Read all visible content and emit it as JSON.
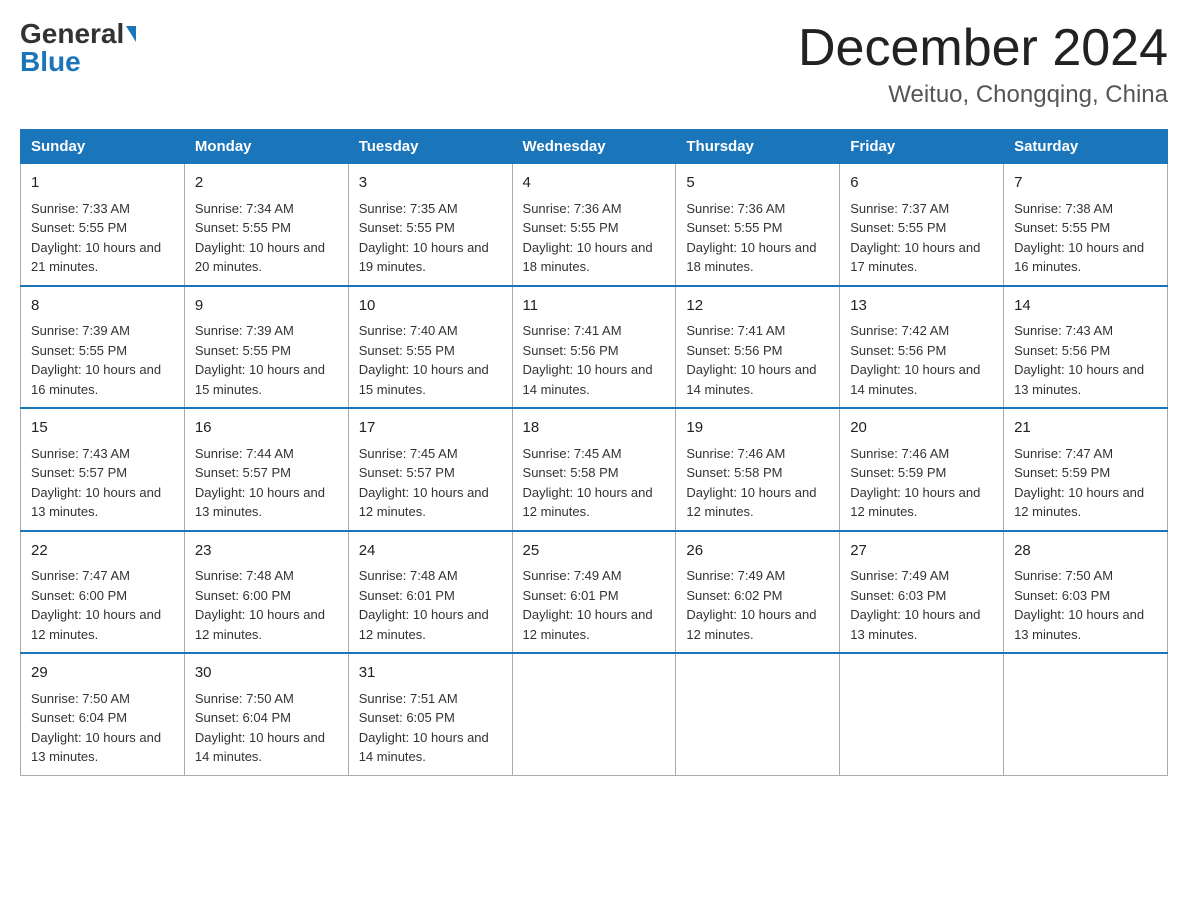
{
  "header": {
    "logo": {
      "general": "General",
      "blue": "Blue"
    },
    "title": "December 2024",
    "location": "Weituo, Chongqing, China"
  },
  "days_of_week": [
    "Sunday",
    "Monday",
    "Tuesday",
    "Wednesday",
    "Thursday",
    "Friday",
    "Saturday"
  ],
  "weeks": [
    [
      {
        "day": "1",
        "sunrise": "7:33 AM",
        "sunset": "5:55 PM",
        "daylight": "10 hours and 21 minutes."
      },
      {
        "day": "2",
        "sunrise": "7:34 AM",
        "sunset": "5:55 PM",
        "daylight": "10 hours and 20 minutes."
      },
      {
        "day": "3",
        "sunrise": "7:35 AM",
        "sunset": "5:55 PM",
        "daylight": "10 hours and 19 minutes."
      },
      {
        "day": "4",
        "sunrise": "7:36 AM",
        "sunset": "5:55 PM",
        "daylight": "10 hours and 18 minutes."
      },
      {
        "day": "5",
        "sunrise": "7:36 AM",
        "sunset": "5:55 PM",
        "daylight": "10 hours and 18 minutes."
      },
      {
        "day": "6",
        "sunrise": "7:37 AM",
        "sunset": "5:55 PM",
        "daylight": "10 hours and 17 minutes."
      },
      {
        "day": "7",
        "sunrise": "7:38 AM",
        "sunset": "5:55 PM",
        "daylight": "10 hours and 16 minutes."
      }
    ],
    [
      {
        "day": "8",
        "sunrise": "7:39 AM",
        "sunset": "5:55 PM",
        "daylight": "10 hours and 16 minutes."
      },
      {
        "day": "9",
        "sunrise": "7:39 AM",
        "sunset": "5:55 PM",
        "daylight": "10 hours and 15 minutes."
      },
      {
        "day": "10",
        "sunrise": "7:40 AM",
        "sunset": "5:55 PM",
        "daylight": "10 hours and 15 minutes."
      },
      {
        "day": "11",
        "sunrise": "7:41 AM",
        "sunset": "5:56 PM",
        "daylight": "10 hours and 14 minutes."
      },
      {
        "day": "12",
        "sunrise": "7:41 AM",
        "sunset": "5:56 PM",
        "daylight": "10 hours and 14 minutes."
      },
      {
        "day": "13",
        "sunrise": "7:42 AM",
        "sunset": "5:56 PM",
        "daylight": "10 hours and 14 minutes."
      },
      {
        "day": "14",
        "sunrise": "7:43 AM",
        "sunset": "5:56 PM",
        "daylight": "10 hours and 13 minutes."
      }
    ],
    [
      {
        "day": "15",
        "sunrise": "7:43 AM",
        "sunset": "5:57 PM",
        "daylight": "10 hours and 13 minutes."
      },
      {
        "day": "16",
        "sunrise": "7:44 AM",
        "sunset": "5:57 PM",
        "daylight": "10 hours and 13 minutes."
      },
      {
        "day": "17",
        "sunrise": "7:45 AM",
        "sunset": "5:57 PM",
        "daylight": "10 hours and 12 minutes."
      },
      {
        "day": "18",
        "sunrise": "7:45 AM",
        "sunset": "5:58 PM",
        "daylight": "10 hours and 12 minutes."
      },
      {
        "day": "19",
        "sunrise": "7:46 AM",
        "sunset": "5:58 PM",
        "daylight": "10 hours and 12 minutes."
      },
      {
        "day": "20",
        "sunrise": "7:46 AM",
        "sunset": "5:59 PM",
        "daylight": "10 hours and 12 minutes."
      },
      {
        "day": "21",
        "sunrise": "7:47 AM",
        "sunset": "5:59 PM",
        "daylight": "10 hours and 12 minutes."
      }
    ],
    [
      {
        "day": "22",
        "sunrise": "7:47 AM",
        "sunset": "6:00 PM",
        "daylight": "10 hours and 12 minutes."
      },
      {
        "day": "23",
        "sunrise": "7:48 AM",
        "sunset": "6:00 PM",
        "daylight": "10 hours and 12 minutes."
      },
      {
        "day": "24",
        "sunrise": "7:48 AM",
        "sunset": "6:01 PM",
        "daylight": "10 hours and 12 minutes."
      },
      {
        "day": "25",
        "sunrise": "7:49 AM",
        "sunset": "6:01 PM",
        "daylight": "10 hours and 12 minutes."
      },
      {
        "day": "26",
        "sunrise": "7:49 AM",
        "sunset": "6:02 PM",
        "daylight": "10 hours and 12 minutes."
      },
      {
        "day": "27",
        "sunrise": "7:49 AM",
        "sunset": "6:03 PM",
        "daylight": "10 hours and 13 minutes."
      },
      {
        "day": "28",
        "sunrise": "7:50 AM",
        "sunset": "6:03 PM",
        "daylight": "10 hours and 13 minutes."
      }
    ],
    [
      {
        "day": "29",
        "sunrise": "7:50 AM",
        "sunset": "6:04 PM",
        "daylight": "10 hours and 13 minutes."
      },
      {
        "day": "30",
        "sunrise": "7:50 AM",
        "sunset": "6:04 PM",
        "daylight": "10 hours and 14 minutes."
      },
      {
        "day": "31",
        "sunrise": "7:51 AM",
        "sunset": "6:05 PM",
        "daylight": "10 hours and 14 minutes."
      },
      null,
      null,
      null,
      null
    ]
  ]
}
